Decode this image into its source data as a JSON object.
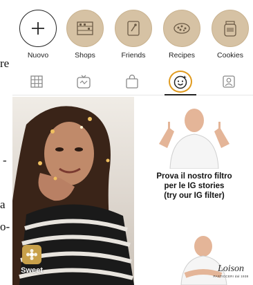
{
  "page_scraps": [
    "re",
    "-",
    "a",
    "o-"
  ],
  "highlights": [
    {
      "label": "Nuovo",
      "icon": "plus-icon"
    },
    {
      "label": "Shops",
      "icon": "shop-shelf-icon"
    },
    {
      "label": "Friends",
      "icon": "chef-card-icon"
    },
    {
      "label": "Recipes",
      "icon": "cookie-tray-icon"
    },
    {
      "label": "Cookies",
      "icon": "jar-icon"
    }
  ],
  "tabs": [
    {
      "icon": "grid-icon"
    },
    {
      "icon": "igtv-icon"
    },
    {
      "icon": "shopping-bag-icon"
    },
    {
      "icon": "effects-face-icon",
      "active": true
    },
    {
      "icon": "tagged-user-icon"
    }
  ],
  "grid": {
    "left_filter_label": "Sweet",
    "promo_lines": [
      "Prova il nostro filtro",
      "per le IG stories",
      "(try our IG filter)"
    ],
    "brand_name": "Loison",
    "brand_tagline": "PASTICCERI dal 1938"
  },
  "colors": {
    "accent_focus": "#e09a1e",
    "story_ring": "#d6c2a4",
    "text": "#222222"
  }
}
